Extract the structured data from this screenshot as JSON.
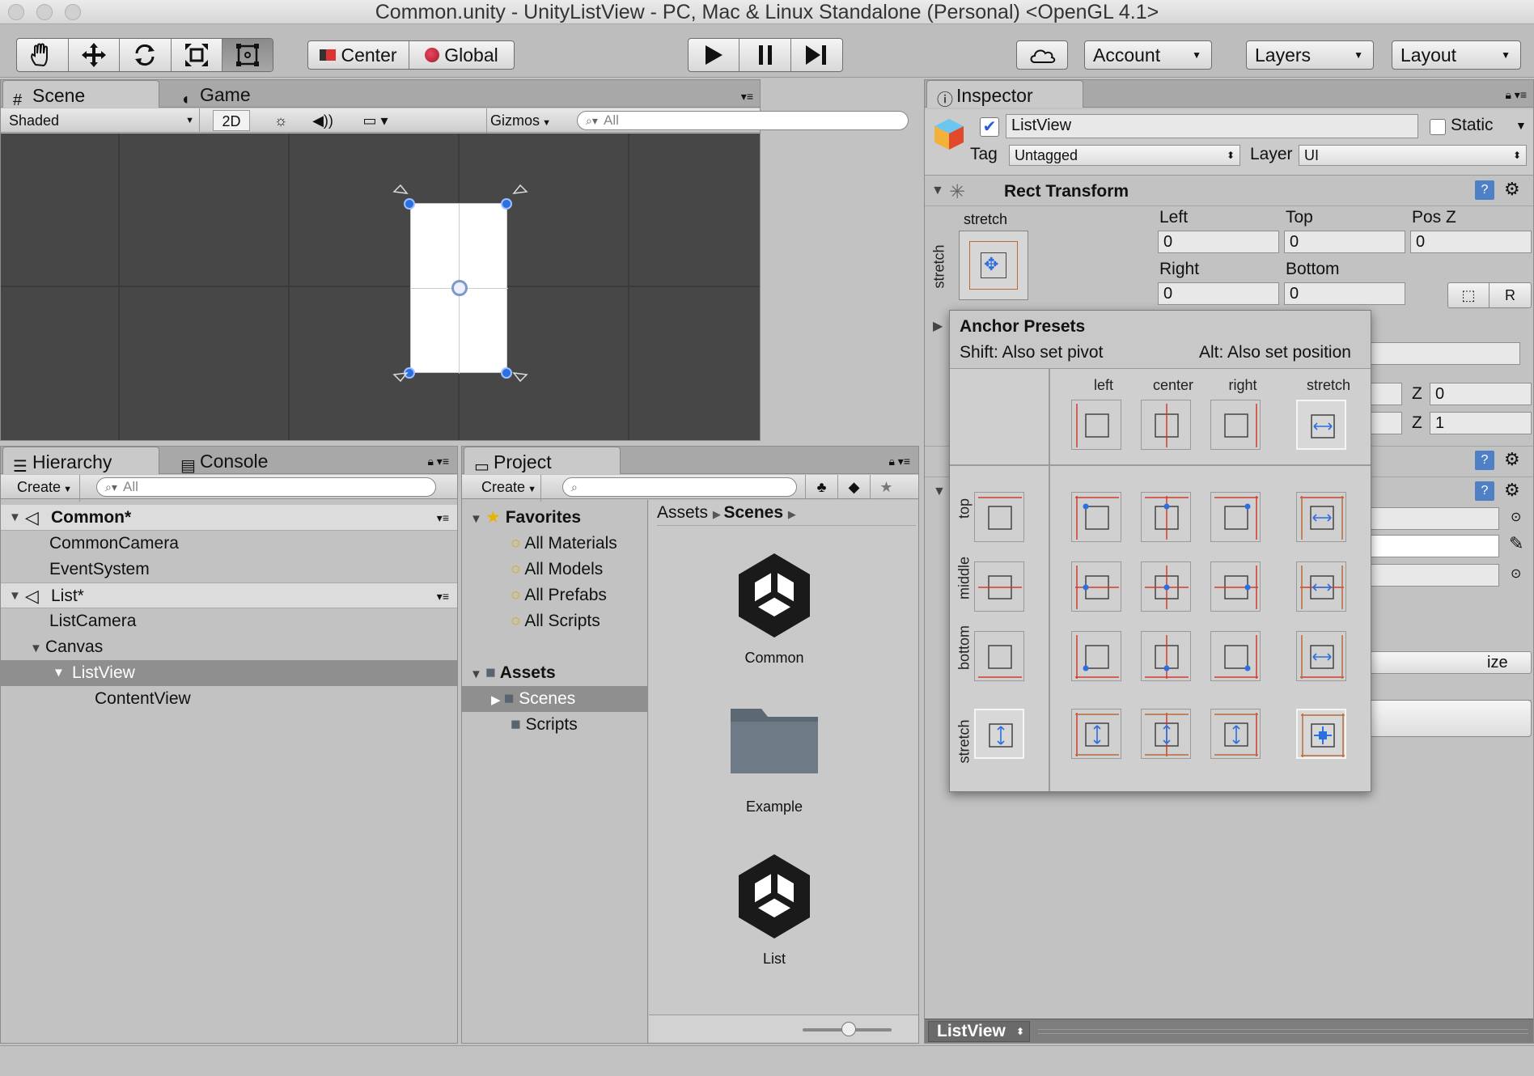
{
  "window": {
    "title": "Common.unity - UnityListView - PC, Mac & Linux Standalone (Personal) <OpenGL 4.1>"
  },
  "toolbar": {
    "tools": [
      "hand-tool-icon",
      "move-tool-icon",
      "rotate-tool-icon",
      "scale-tool-icon",
      "rect-tool-icon"
    ],
    "pivot_label": "Center",
    "space_label": "Global",
    "account_label": "Account",
    "layers_label": "Layers",
    "layout_label": "Layout"
  },
  "scene": {
    "tabs": [
      "Scene",
      "Game"
    ],
    "shading": "Shaded",
    "mode_2d": "2D",
    "gizmos_label": "Gizmos",
    "search_placeholder": "All"
  },
  "hierarchy": {
    "tabs": [
      "Hierarchy",
      "Console"
    ],
    "create_label": "Create",
    "search_placeholder": "All",
    "items": [
      {
        "label": "Common*",
        "type": "scene"
      },
      {
        "label": "CommonCamera"
      },
      {
        "label": "EventSystem"
      },
      {
        "label": "List*",
        "type": "scene"
      },
      {
        "label": "ListCamera"
      },
      {
        "label": "Canvas"
      },
      {
        "label": "ListView",
        "selected": true
      },
      {
        "label": "ContentView"
      }
    ]
  },
  "project": {
    "tab": "Project",
    "create_label": "Create",
    "favorites_label": "Favorites",
    "favorites": [
      "All Materials",
      "All Models",
      "All Prefabs",
      "All Scripts"
    ],
    "assets_label": "Assets",
    "folders": [
      "Scenes",
      "Scripts"
    ],
    "breadcrumb": [
      "Assets",
      "Scenes"
    ],
    "grid_items": [
      {
        "label": "Common",
        "icon": "unity-scene-icon"
      },
      {
        "label": "Example",
        "icon": "folder-icon"
      },
      {
        "label": "List",
        "icon": "unity-scene-icon"
      }
    ]
  },
  "inspector": {
    "tab": "Inspector",
    "object_name": "ListView",
    "active": true,
    "static_label": "Static",
    "tag_label": "Tag",
    "tag_value": "Untagged",
    "layer_label": "Layer",
    "layer_value": "UI",
    "rect_transform": {
      "title": "Rect Transform",
      "anchor_label": "stretch",
      "anchor_side_label": "stretch",
      "left_label": "Left",
      "left_value": "0",
      "top_label": "Top",
      "top_value": "0",
      "posz_label": "Pos Z",
      "posz_value": "0",
      "right_label": "Right",
      "right_value": "0",
      "bottom_label": "Bottom",
      "bottom_value": "0",
      "raw_button": "R"
    },
    "z_label": "Z",
    "rotation_z": "0",
    "scale_z": "1",
    "size_fragment": "ize",
    "footer_object": "ListView"
  },
  "anchor_presets": {
    "title": "Anchor Presets",
    "hint_left": "Shift: Also set pivot",
    "hint_right": "Alt: Also set position",
    "columns": [
      "left",
      "center",
      "right",
      "stretch"
    ],
    "rows": [
      "top",
      "middle",
      "bottom",
      "stretch"
    ]
  }
}
